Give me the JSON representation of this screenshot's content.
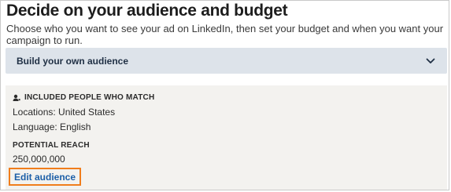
{
  "page": {
    "title": "Decide on your audience and budget",
    "subtitle": "Choose who you want to see your ad on LinkedIn, then set your budget and when you want your campaign to run."
  },
  "audience_panel": {
    "label": "Build your own audience",
    "icon": "chevron-down-icon",
    "expanded": false
  },
  "summary": {
    "included_heading": "INCLUDED PEOPLE WHO MATCH",
    "heading_icon": "people-icon",
    "locations": "Locations: United States",
    "language": "Language: English",
    "reach_heading": "POTENTIAL REACH",
    "reach_value": "250,000,000",
    "edit_link": "Edit audience"
  },
  "colors": {
    "panel_bg": "#dde3ea",
    "summary_bg": "#f3f2ef",
    "link": "#1c5fa8",
    "highlight": "#f07d1b"
  }
}
